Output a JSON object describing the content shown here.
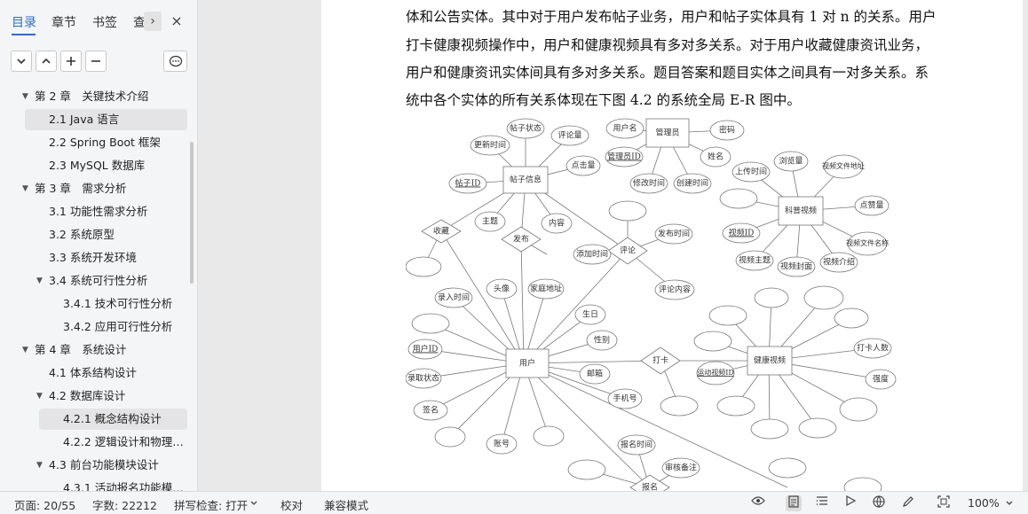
{
  "sidebar": {
    "tabs": [
      {
        "label": "目录"
      },
      {
        "label": "章节"
      },
      {
        "label": "书签"
      },
      {
        "label": "查"
      }
    ],
    "next_icon": "›",
    "close_icon": "×",
    "toolbar": {
      "collapse": "⌄",
      "expand": "⌃",
      "add": "+",
      "remove": "−",
      "more": "⋯"
    },
    "toc": [
      {
        "label": "第 2 章　关键技术介绍",
        "level": 1,
        "arrow": "▼"
      },
      {
        "label": "2.1 Java 语言",
        "level": 2
      },
      {
        "label": "2.2 Spring Boot 框架",
        "level": 2
      },
      {
        "label": "2.3 MySQL 数据库",
        "level": 2
      },
      {
        "label": "第 3 章　需求分析",
        "level": 1,
        "arrow": "▼"
      },
      {
        "label": "3.1  功能性需求分析",
        "level": 2
      },
      {
        "label": "3.2  系统原型",
        "level": 2
      },
      {
        "label": "3.3  系统开发环境",
        "level": 2
      },
      {
        "label": "3.4  系统可行性分析",
        "level": 2,
        "arrow": "▼"
      },
      {
        "label": "3.4.1  技术可行性分析",
        "level": 3
      },
      {
        "label": "3.4.2  应用可行性分析",
        "level": 3
      },
      {
        "label": "第 4 章　系统设计",
        "level": 1,
        "arrow": "▼"
      },
      {
        "label": "4.1  体系结构设计",
        "level": 2
      },
      {
        "label": "4.2  数据库设计",
        "level": 2,
        "arrow": "▼"
      },
      {
        "label": "4.2.1  概念结构设计",
        "level": 3
      },
      {
        "label": "4.2.2  逻辑设计和物理…",
        "level": 3
      },
      {
        "label": "4.3  前台功能模块设计",
        "level": 2,
        "arrow": "▼"
      },
      {
        "label": "4.3.1 活动报名功能模…",
        "level": 3
      }
    ]
  },
  "document": {
    "lines": [
      "体和公告实体。其中对于用户发布帖子业务，用户和帖子实体具有 1 对 n 的关系。用户",
      "打卡健康视频操作中，用户和健康视频具有多对多关系。对于用户收藏健康资讯业务，",
      "用户和健康资讯实体间具有多对多关系。题目答案和题目实体之间具有一对多关系。系",
      "统中各个实体的所有关系体现在下图 4.2 的系统全局 E-R 图中。"
    ],
    "er": {
      "entities": [
        "帖子信息",
        "管理员",
        "科普视频",
        "用户",
        "健康视频"
      ],
      "relations": [
        "收藏",
        "发布",
        "评论",
        "打卡",
        "报名"
      ],
      "attributes": [
        "帖子状态",
        "评论量",
        "更新时间",
        "点击量",
        "帖子ID",
        "主题",
        "内容",
        "用户名",
        "密码",
        "管理员ID",
        "姓名",
        "修改时间",
        "创建时间",
        "上传时间",
        "浏览量",
        "视频文件地址",
        "点赞量",
        "视频ID",
        "视频文件名称",
        "视频主题",
        "视频封面",
        "视频介绍",
        "添加时间",
        "发布时间",
        "评论内容",
        "录入时间",
        "头像",
        "家庭地址",
        "生日",
        "性别",
        "用户ID",
        "邮箱",
        "手机号",
        "录取状态",
        "签名",
        "账号",
        "运动视频ID",
        "打卡人数",
        "强度",
        "报名时间",
        "审核备注"
      ]
    }
  },
  "status": {
    "page": "页面: 20/55",
    "words": "字数: 22212",
    "spell": "拼写检查: 打开",
    "proof": "校对",
    "compat": "兼容模式",
    "zoom": "100%"
  }
}
